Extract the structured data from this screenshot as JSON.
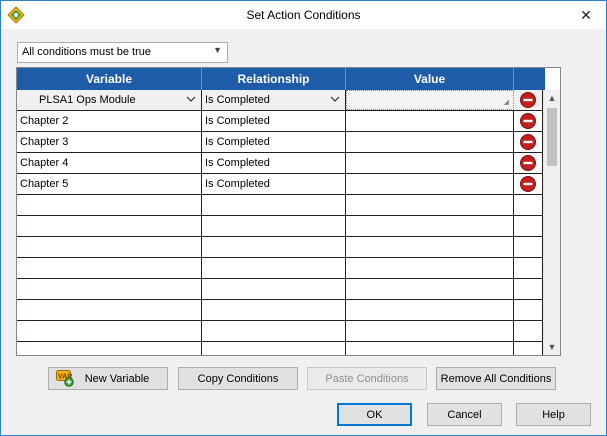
{
  "window": {
    "title": "Set Action Conditions",
    "close_glyph": "✕"
  },
  "condition_mode": {
    "selected": "All conditions must be true"
  },
  "grid": {
    "columns": [
      "Variable",
      "Relationship",
      "Value"
    ],
    "rows": [
      {
        "variable": "PLSA1 Ops Module",
        "relationship": "Is Completed",
        "value": ""
      },
      {
        "variable": "Chapter 2",
        "relationship": "Is Completed",
        "value": ""
      },
      {
        "variable": "Chapter 3",
        "relationship": "Is Completed",
        "value": ""
      },
      {
        "variable": "Chapter 4",
        "relationship": "Is Completed",
        "value": ""
      },
      {
        "variable": "Chapter 5",
        "relationship": "Is Completed",
        "value": ""
      }
    ],
    "empty_rows": 8
  },
  "buttons": {
    "new_variable": "New Variable",
    "copy_conditions": "Copy Conditions",
    "paste_conditions": "Paste Conditions",
    "remove_all": "Remove All Conditions",
    "ok": "OK",
    "cancel": "Cancel",
    "help": "Help"
  },
  "icons": {
    "app": "app-logo-icon",
    "delete": "remove-condition-icon",
    "new_variable": "var-icon"
  },
  "colors": {
    "header_bg": "#1f5ca8",
    "delete_red": "#c0201e",
    "accent_border": "#0078d7"
  }
}
